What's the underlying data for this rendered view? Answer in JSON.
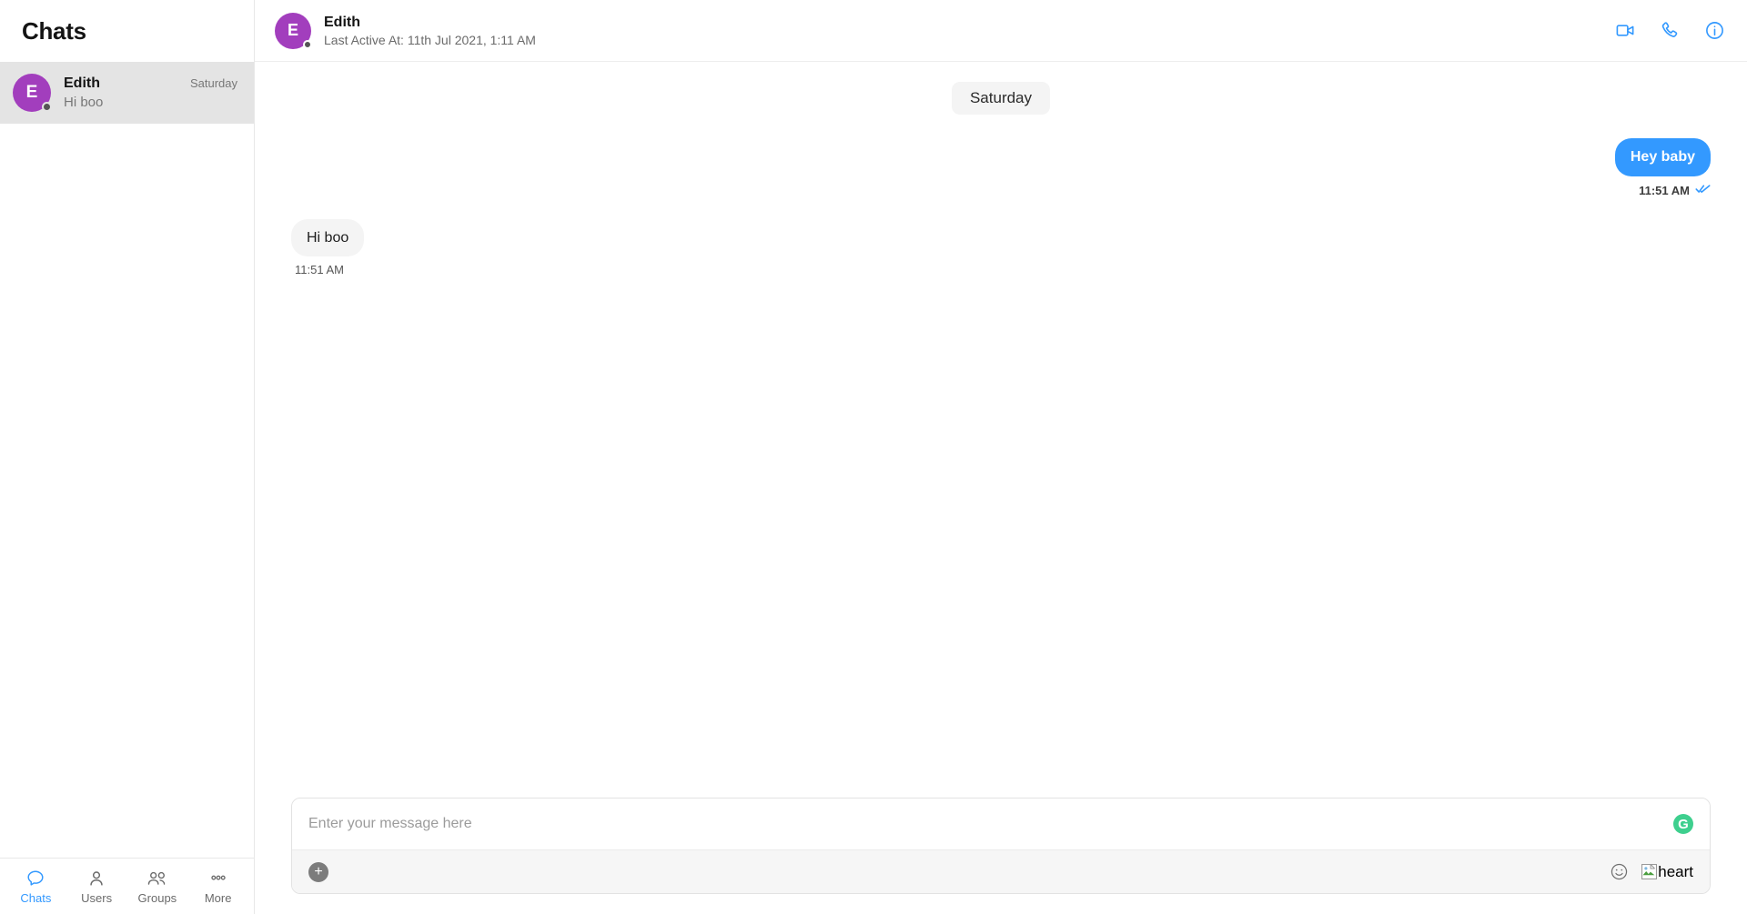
{
  "sidebar": {
    "title": "Chats",
    "chats": [
      {
        "name": "Edith",
        "avatar_initial": "E",
        "time": "Saturday",
        "preview": "Hi boo",
        "status": "offline"
      }
    ],
    "nav": [
      {
        "label": "Chats",
        "icon": "chat-bubble-icon",
        "active": true
      },
      {
        "label": "Users",
        "icon": "user-icon",
        "active": false
      },
      {
        "label": "Groups",
        "icon": "users-group-icon",
        "active": false
      },
      {
        "label": "More",
        "icon": "ellipsis-icon",
        "active": false
      }
    ]
  },
  "conversation": {
    "header": {
      "name": "Edith",
      "avatar_initial": "E",
      "subtitle": "Last Active At: 11th Jul 2021, 1:11 AM",
      "actions": [
        {
          "name": "video-call-icon"
        },
        {
          "name": "phone-call-icon"
        },
        {
          "name": "info-icon"
        }
      ]
    },
    "date_separator": "Saturday",
    "messages": [
      {
        "direction": "outgoing",
        "text": "Hey baby",
        "time": "11:51 AM",
        "receipt": "read"
      },
      {
        "direction": "incoming",
        "text": "Hi boo",
        "time": "11:51 AM",
        "receipt": "none"
      }
    ]
  },
  "composer": {
    "placeholder": "Enter your message here",
    "value": "",
    "grammarly_label": "G",
    "attach_label": "+",
    "emoji_icon": "smiley-icon",
    "sticker_alt_text": "heart"
  },
  "colors": {
    "accent_blue": "#3399ff",
    "avatar_purple": "#a23ebd",
    "grammarly_green": "#3ecf8e",
    "incoming_bubble": "#f4f4f4",
    "selected_row": "#e4e4e4"
  }
}
